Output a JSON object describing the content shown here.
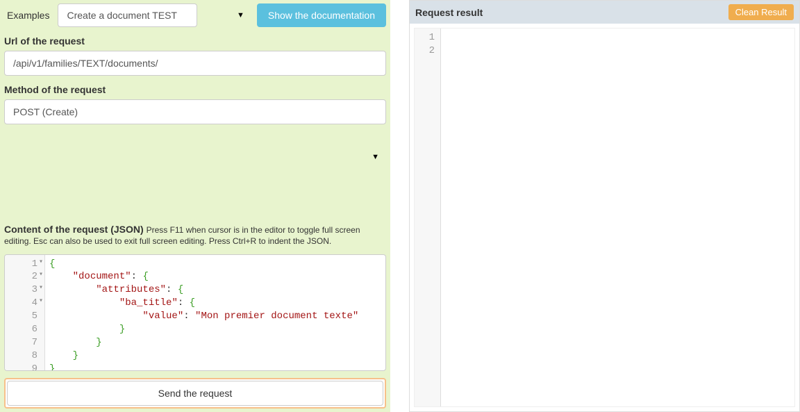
{
  "toolbar": {
    "examples_label": "Examples",
    "examples_selected": "Create a document TEST",
    "show_doc_label": "Show the documentation"
  },
  "url_section": {
    "label": "Url of the request",
    "value": "/api/v1/families/TEXT/documents/"
  },
  "method_section": {
    "label": "Method of the request",
    "selected": "POST (Create)"
  },
  "content_section": {
    "label": "Content of the request (JSON)",
    "hint": "Press F11 when cursor is in the editor to toggle full screen editing. Esc can also be used to exit full screen editing. Press Ctrl+R to indent the JSON."
  },
  "editor": {
    "lines": [
      "1",
      "2",
      "3",
      "4",
      "5",
      "6",
      "7",
      "8",
      "9"
    ],
    "fold_lines": [
      1,
      2,
      3,
      4
    ],
    "code_tokens": [
      [
        {
          "t": "brace",
          "v": "{"
        }
      ],
      [
        {
          "t": "plain",
          "v": "    "
        },
        {
          "t": "key",
          "v": "\"document\""
        },
        {
          "t": "plain",
          "v": ": "
        },
        {
          "t": "brace",
          "v": "{"
        }
      ],
      [
        {
          "t": "plain",
          "v": "        "
        },
        {
          "t": "key",
          "v": "\"attributes\""
        },
        {
          "t": "plain",
          "v": ": "
        },
        {
          "t": "brace",
          "v": "{"
        }
      ],
      [
        {
          "t": "plain",
          "v": "            "
        },
        {
          "t": "key",
          "v": "\"ba_title\""
        },
        {
          "t": "plain",
          "v": ": "
        },
        {
          "t": "brace",
          "v": "{"
        }
      ],
      [
        {
          "t": "plain",
          "v": "                "
        },
        {
          "t": "key",
          "v": "\"value\""
        },
        {
          "t": "plain",
          "v": ": "
        },
        {
          "t": "str",
          "v": "\"Mon premier document texte\""
        }
      ],
      [
        {
          "t": "plain",
          "v": "            "
        },
        {
          "t": "brace",
          "v": "}"
        }
      ],
      [
        {
          "t": "plain",
          "v": "        "
        },
        {
          "t": "brace",
          "v": "}"
        }
      ],
      [
        {
          "t": "plain",
          "v": "    "
        },
        {
          "t": "brace",
          "v": "}"
        }
      ],
      [
        {
          "t": "brace",
          "v": "}"
        }
      ]
    ]
  },
  "send_button": "Send the request",
  "result": {
    "title": "Request result",
    "clean_label": "Clean Result",
    "lines": [
      "1",
      "2"
    ]
  }
}
